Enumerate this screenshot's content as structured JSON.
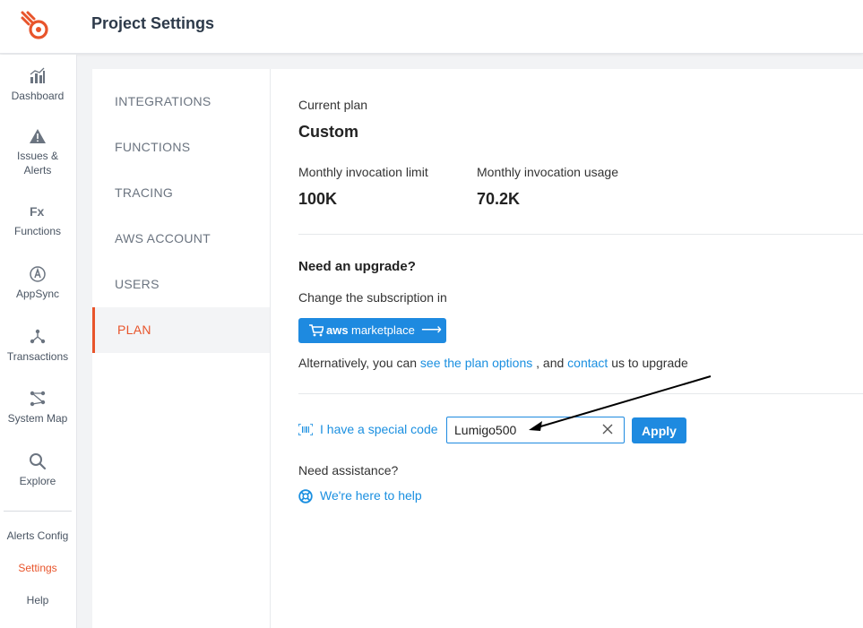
{
  "header": {
    "title": "Project Settings"
  },
  "leftnav": {
    "items": [
      {
        "label": "Dashboard",
        "icon": "bar-chart-icon"
      },
      {
        "label": "Issues & Alerts",
        "icon": "warning-icon"
      },
      {
        "label": "Functions",
        "icon": "fx-icon"
      },
      {
        "label": "AppSync",
        "icon": "appsync-icon"
      },
      {
        "label": "Transactions",
        "icon": "transactions-icon"
      },
      {
        "label": "System Map",
        "icon": "system-map-icon"
      },
      {
        "label": "Explore",
        "icon": "search-icon"
      }
    ],
    "bottom": [
      "Alerts Config",
      "Settings",
      "Help"
    ],
    "active": "Settings",
    "accent": "#e8542b"
  },
  "subnav": {
    "items": [
      "INTEGRATIONS",
      "FUNCTIONS",
      "TRACING",
      "AWS ACCOUNT",
      "USERS",
      "PLAN"
    ],
    "active": "PLAN"
  },
  "plan": {
    "current_label": "Current plan",
    "current_value": "Custom",
    "limit_label": "Monthly invocation limit",
    "limit_value": "100K",
    "usage_label": "Monthly invocation usage",
    "usage_value": "70.2K",
    "upgrade_heading": "Need an upgrade?",
    "change_text": "Change the subscription in",
    "aws_button": {
      "bold": "aws",
      "text": "marketplace",
      "arrow": "⟶"
    },
    "alt_prefix": "Alternatively, you can",
    "alt_link1": "see the plan options",
    "alt_mid": ", and",
    "alt_link2": "contact",
    "alt_suffix": "us to upgrade",
    "special_code_link": "I have a special code",
    "code_value": "Lumigo500",
    "apply_label": "Apply",
    "assistance_label": "Need assistance?",
    "help_link": "We're here to help"
  },
  "colors": {
    "primary": "#1e8ae0",
    "accent": "#e8542b"
  }
}
